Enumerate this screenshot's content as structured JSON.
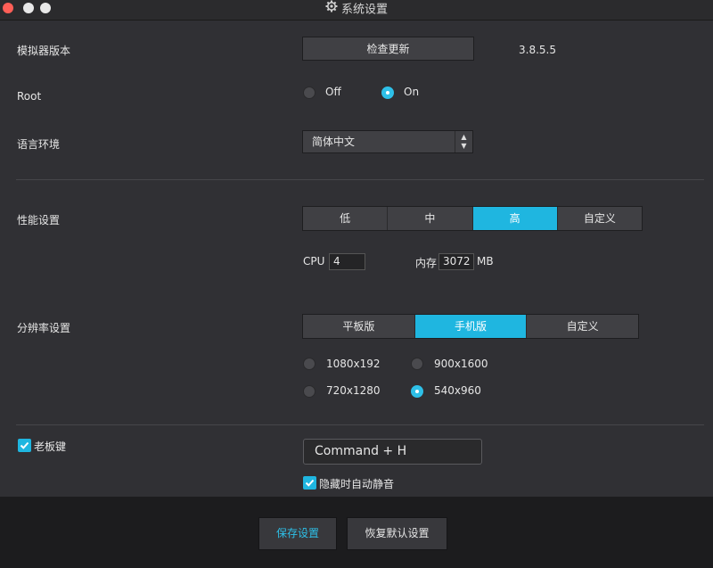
{
  "window": {
    "title": "系统设置"
  },
  "version": {
    "label": "模拟器版本",
    "check_button": "检查更新",
    "value": "3.8.5.5"
  },
  "root": {
    "label": "Root",
    "options": [
      {
        "label": "Off",
        "selected": false
      },
      {
        "label": "On",
        "selected": true
      }
    ]
  },
  "language": {
    "label": "语言环境",
    "selected": "简体中文"
  },
  "performance": {
    "label": "性能设置",
    "options": [
      "低",
      "中",
      "高",
      "自定义"
    ],
    "active": "高",
    "cpu_label": "CPU",
    "cpu_value": "4",
    "memory_label": "内存",
    "memory_value": "3072",
    "memory_unit": "MB"
  },
  "resolution": {
    "label": "分辨率设置",
    "modes": [
      "平板版",
      "手机版",
      "自定义"
    ],
    "active_mode": "手机版",
    "options": [
      {
        "label": "1080x192",
        "selected": false
      },
      {
        "label": "900x1600",
        "selected": false
      },
      {
        "label": "720x1280",
        "selected": false
      },
      {
        "label": "540x960",
        "selected": true
      }
    ]
  },
  "boss_key": {
    "label": "老板键",
    "checked": true,
    "hotkey": "Command + H",
    "mute_label": "隐藏时自动静音",
    "mute_checked": true
  },
  "footer": {
    "save_label": "保存设置",
    "reset_label": "恢复默认设置"
  },
  "colors": {
    "accent": "#1fb6e0",
    "panel": "#303034",
    "footer": "#1c1c1e"
  }
}
